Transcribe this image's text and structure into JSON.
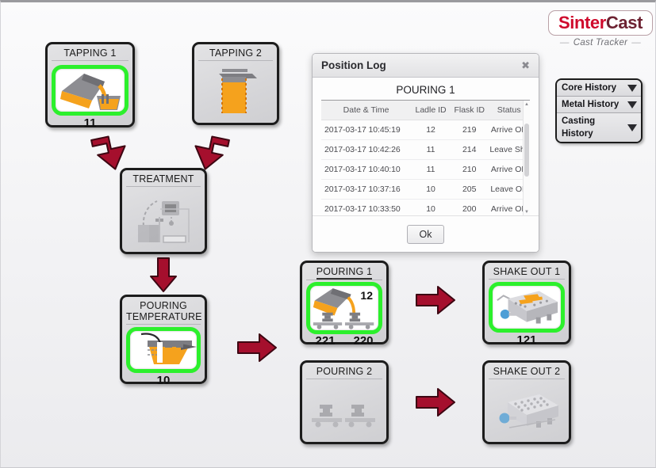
{
  "branding": {
    "logo_primary": "Sinter",
    "logo_secondary": "Cast",
    "tagline": "Cast Tracker",
    "dash": "—",
    "color_primary": "#cf0a2c",
    "color_secondary": "#6d2232"
  },
  "history_menu": {
    "items": [
      {
        "label": "Core History",
        "icon": "chevron-down-icon"
      },
      {
        "label": "Metal History",
        "icon": "chevron-down-icon"
      },
      {
        "label": "Casting History",
        "icon": "chevron-down-icon"
      }
    ]
  },
  "process_nodes": {
    "tapping1": {
      "title": "TAPPING 1",
      "count": "11",
      "active": true,
      "icon": "tilting-ladle-icon"
    },
    "tapping2": {
      "title": "TAPPING 2",
      "count": "",
      "active": false,
      "icon": "upright-vessel-icon"
    },
    "treatment": {
      "title": "TREATMENT",
      "count": "",
      "active": false,
      "icon": "treatment-station-icon"
    },
    "pouring_temperature": {
      "title": "POURING\nTEMPERATURE",
      "count": "10",
      "active": true,
      "icon": "crucible-probe-icon"
    },
    "pouring1": {
      "title": "POURING 1",
      "badge": "12",
      "count_left": "221",
      "count_right": "220",
      "active": true,
      "icon": "pouring-ladle-carts-icon"
    },
    "pouring2": {
      "title": "POURING 2",
      "active": false,
      "icon": "empty-carts-icon"
    },
    "shakeout1": {
      "title": "SHAKE OUT 1",
      "count": "121",
      "active": true,
      "icon": "shakeout-machine-icon"
    },
    "shakeout2": {
      "title": "SHAKE OUT  2",
      "count": "",
      "active": false,
      "icon": "shakeout-machine-icon"
    }
  },
  "arrows": {
    "color": "#a50f2d",
    "items": [
      {
        "name": "arrow-tapping1-to-treatment",
        "direction": "down-right"
      },
      {
        "name": "arrow-tapping2-to-treatment",
        "direction": "down-left"
      },
      {
        "name": "arrow-treatment-to-pouring-temperature",
        "direction": "down"
      },
      {
        "name": "arrow-pouring-temperature-to-pouring1",
        "direction": "right"
      },
      {
        "name": "arrow-pouring1-to-shakeout1",
        "direction": "right"
      },
      {
        "name": "arrow-pouring2-to-shakeout2",
        "direction": "right"
      }
    ]
  },
  "dialog": {
    "title": "Position Log",
    "close_icon": "close-icon",
    "subtitle": "POURING 1",
    "ok_label": "Ok",
    "columns": [
      "Date & Time",
      "Ladle ID",
      "Flask ID",
      "Status"
    ],
    "rows": [
      {
        "datetime": "2017-03-17  10:45:19",
        "ladle_id": "12",
        "flask_id": "219",
        "status": "Arrive OK"
      },
      {
        "datetime": "2017-03-17  10:42:26",
        "ladle_id": "11",
        "flask_id": "214",
        "status": "Leave Short"
      },
      {
        "datetime": "2017-03-17  10:40:10",
        "ladle_id": "11",
        "flask_id": "210",
        "status": "Arrive OK"
      },
      {
        "datetime": "2017-03-17  10:37:16",
        "ladle_id": "10",
        "flask_id": "205",
        "status": "Leave OK"
      },
      {
        "datetime": "2017-03-17  10:33:50",
        "ladle_id": "10",
        "flask_id": "200",
        "status": "Arrive OK"
      }
    ],
    "scrollbar": {
      "up_icon": "scroll-up-icon",
      "down_icon": "scroll-down-icon"
    }
  }
}
